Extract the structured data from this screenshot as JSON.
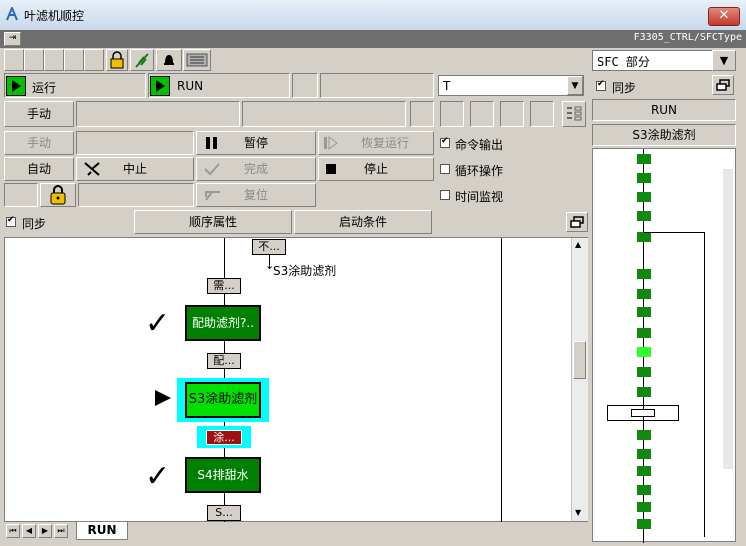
{
  "window": {
    "title": "叶滤机顺控",
    "close_label": "✕"
  },
  "menubar": {
    "path": "F3305_CTRL/SFCType"
  },
  "status": {
    "mode_text": "运行",
    "mode_value": "RUN",
    "dropdown_value": "T"
  },
  "buttons": {
    "manual_toggle": "手动",
    "manual": "手动",
    "auto": "自动",
    "pause": "暂停",
    "resume": "恢复运行",
    "abort": "中止",
    "complete": "完成",
    "stop": "停止",
    "reset": "复位"
  },
  "options": {
    "command_output": "命令输出",
    "cyclic": "循环操作",
    "time_monitor": "时间监视"
  },
  "bottom": {
    "sync": "同步",
    "seq_props": "顺序属性",
    "start_cond": "启动条件"
  },
  "chart": {
    "trans_top": "不...",
    "trans_top_target": "S3涂助滤剂",
    "trans_1": "需...",
    "step_1": "配助滤剂?..",
    "trans_2": "配...",
    "step_2": "S3涂助滤剂",
    "trans_3": "涂...",
    "step_3": "S4排甜水",
    "trans_4": "S..."
  },
  "tabs": {
    "run": "RUN"
  },
  "right": {
    "sfc_label": "SFC 部分",
    "sync": "同步",
    "run": "RUN",
    "step": "S3涂助滤剂"
  },
  "colors": {
    "step_green": "#008000",
    "active_step": "#00e000",
    "highlight": "#00ffff",
    "active_trans": "#a01010"
  }
}
